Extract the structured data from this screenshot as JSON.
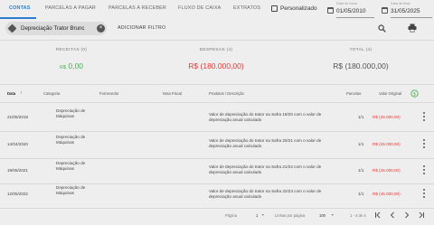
{
  "nav": {
    "tabs": [
      "CONTAS",
      "PARCELAS A PAGAR",
      "PARCELAS A RECEBER",
      "FLUXO DE CAIXA",
      "EXTRATOS"
    ],
    "personalizado": "Personalizado",
    "date_start_caption": "Data de início",
    "date_start": "01/05/2010",
    "date_end_caption": "Data de final",
    "date_end": "31/05/2025"
  },
  "filter": {
    "chip_label": "Depreciação Trator Brunc",
    "add_filter": "ADICIONAR FILTRO"
  },
  "summary": {
    "receitas_label": "RECEITAS (0)",
    "receitas_currency": "R$",
    "receitas_value": "0,00",
    "despesas_label": "DESPESAS (4)",
    "despesas_value": "R$ (180.000,00)",
    "total_label": "TOTAL (4)",
    "total_value": "R$ (180.000,00)",
    "colors": {
      "receitas": "#4caf50",
      "despesas": "#e53935",
      "total": "#555555"
    }
  },
  "table": {
    "headers": {
      "data": "Data",
      "categoria": "Categoria",
      "fornecedor": "Fornecedor",
      "nota_fiscal": "Nota Fiscal",
      "produtos": "Produtos / Descrição",
      "parcelas": "Parcelas",
      "valor": "Valor Original"
    },
    "rows": [
      {
        "date": "21/05/2019",
        "category": "Depreciação de Máquinas",
        "description": "Valor de depreciação do trator na Safra 19/20 com o valor de depreciação anual calculado",
        "parcelas": "1/1",
        "value": "R$ (45.000,00)"
      },
      {
        "date": "14/04/2020",
        "category": "Depreciação de Máquinas",
        "description": "Valor de depreciação do trator na Safra 20/21 com o valor de depreciação anual calculado",
        "parcelas": "1/1",
        "value": "R$ (45.000,00)"
      },
      {
        "date": "19/05/2021",
        "category": "Depreciação de Máquinas",
        "description": "Valor de depreciação do trator na Safra 21/22 com o valor de depreciação anual calculado",
        "parcelas": "1/1",
        "value": "R$ (45.000,00)"
      },
      {
        "date": "12/05/2022",
        "category": "Depreciação de Máquinas",
        "description": "Valor de depreciação do trator na Safra 22/23 com o valor de depreciação anual calculado",
        "parcelas": "1/1",
        "value": "R$ (45.000,00)"
      }
    ]
  },
  "footer": {
    "page_label": "Página",
    "page_value": "1",
    "rows_label": "Linhas por página",
    "rows_value": "100",
    "range": "1 - 4 de 4"
  }
}
